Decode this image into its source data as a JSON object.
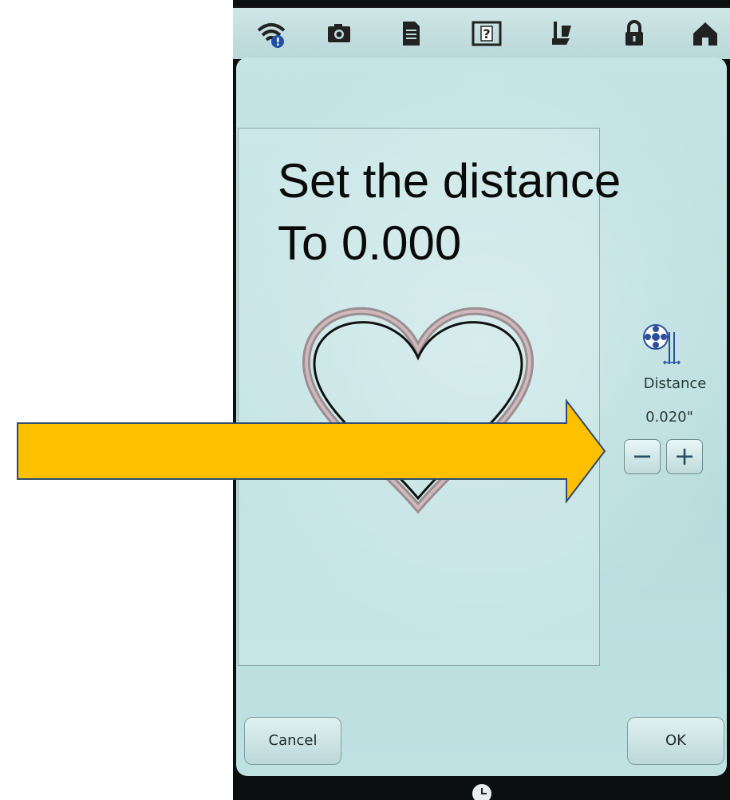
{
  "status_bar": {
    "icons": [
      "wifi-warning-icon",
      "camera-icon",
      "document-icon",
      "help-icon",
      "presser-foot-icon",
      "lock-icon",
      "home-icon"
    ]
  },
  "panel": {
    "setting_label": "Distance",
    "setting_value": "0.020\"",
    "minus_label": "−",
    "plus_label": "+",
    "cancel_label": "Cancel",
    "ok_label": "OK"
  },
  "annotation": {
    "text": "Set the distance\nTo 0.000"
  },
  "colors": {
    "arrow_fill": "#ffc000",
    "arrow_stroke": "#2f4b6e",
    "screen_bg": "#c2e2e3"
  }
}
